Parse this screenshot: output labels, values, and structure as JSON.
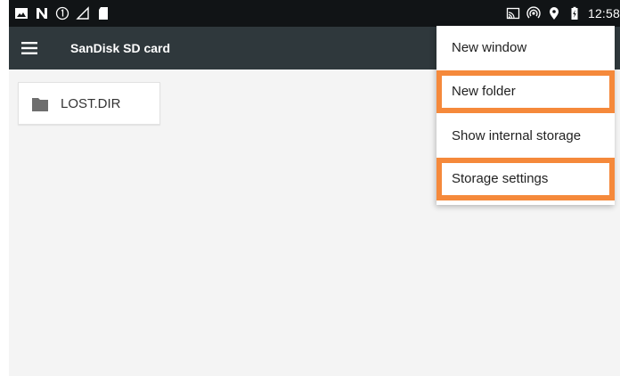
{
  "status_bar": {
    "time": "12:58",
    "left_icons": [
      "image-icon",
      "n-notification-icon",
      "number-one-icon",
      "signal-outline-icon",
      "sd-card-icon"
    ],
    "right_icons": [
      "cast-icon",
      "hotspot-icon",
      "location-pin-icon",
      "battery-charging-icon"
    ]
  },
  "toolbar": {
    "title": "SanDisk SD card",
    "menu_icon": "hamburger-menu-icon"
  },
  "files": [
    {
      "name": "LOST.DIR",
      "icon": "folder-icon"
    }
  ],
  "overflow_menu": {
    "items": [
      {
        "label": "New window",
        "highlighted": false
      },
      {
        "label": "New folder",
        "highlighted": true
      },
      {
        "label": "Show internal storage",
        "highlighted": false
      },
      {
        "label": "Storage settings",
        "highlighted": true
      }
    ]
  },
  "colors": {
    "status_bar_bg": "#111416",
    "toolbar_bg": "#2f383c",
    "content_bg": "#f4f4f4",
    "highlight_outline": "#f5893b"
  }
}
